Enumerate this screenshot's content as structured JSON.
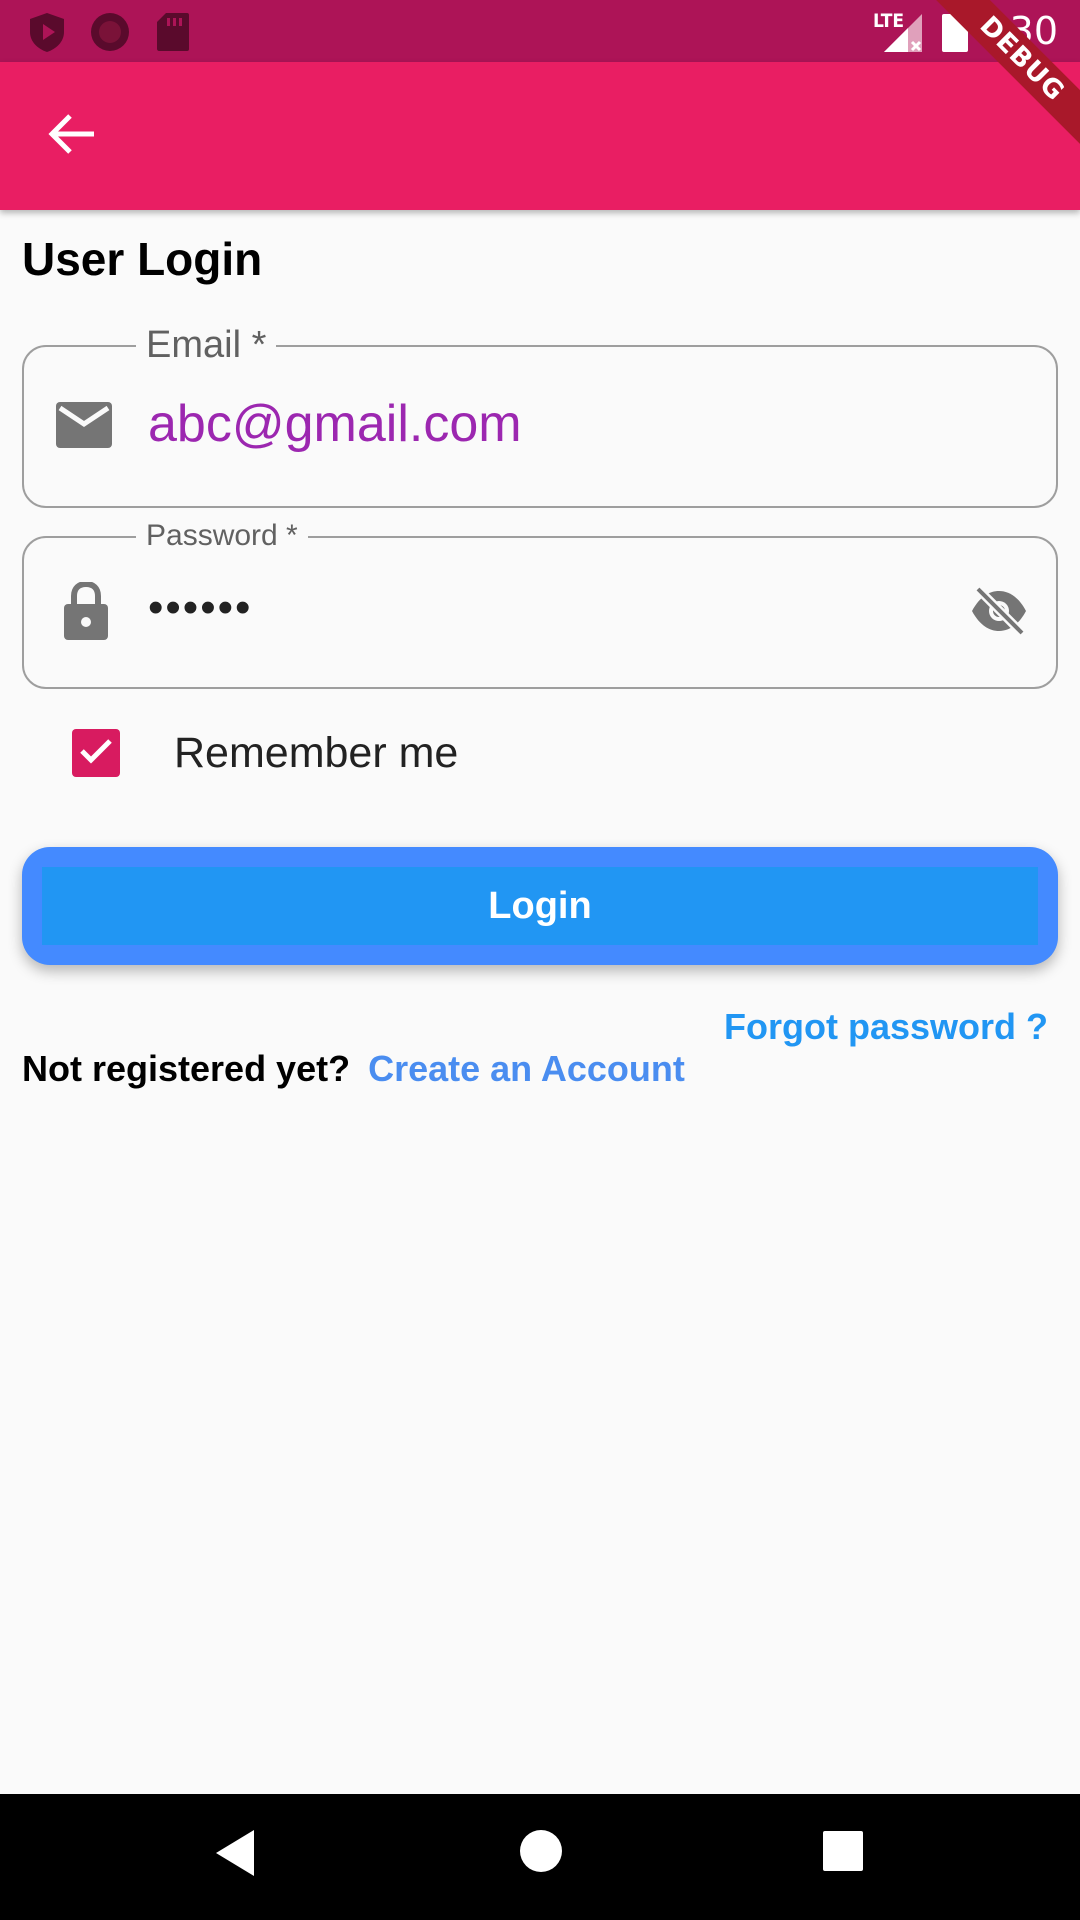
{
  "status_bar": {
    "time": "6:30",
    "network": "LTE",
    "icons": [
      "play-protect-icon",
      "record-icon",
      "sd-card-icon",
      "signal-icon",
      "battery-icon"
    ]
  },
  "debug_banner": {
    "label": "DEBUG"
  },
  "app_bar": {
    "back_icon": "arrow-back-icon",
    "color": "#e91e63"
  },
  "page": {
    "title": "User Login"
  },
  "email": {
    "label": "Email *",
    "value": "abc@gmail.com",
    "icon": "mail-icon"
  },
  "password": {
    "label": "Password *",
    "value": "••••••",
    "icon": "lock-icon",
    "toggle_icon": "visibility-off-icon"
  },
  "remember": {
    "label": "Remember me",
    "checked": true
  },
  "login": {
    "label": "Login"
  },
  "forgot": {
    "label": "Forgot password ?"
  },
  "register": {
    "prompt": "Not registered yet?",
    "link": "Create an Account"
  },
  "nav": {
    "buttons": [
      "back-triangle-icon",
      "home-circle-icon",
      "recents-square-icon"
    ]
  },
  "colors": {
    "status_bar": "#ad1457",
    "app_bar": "#e91e63",
    "email_text": "#9c27b0",
    "checkbox": "#d81b60",
    "login_outer": "#448aff",
    "login_inner": "#2196f3",
    "link": "#2196f3"
  }
}
